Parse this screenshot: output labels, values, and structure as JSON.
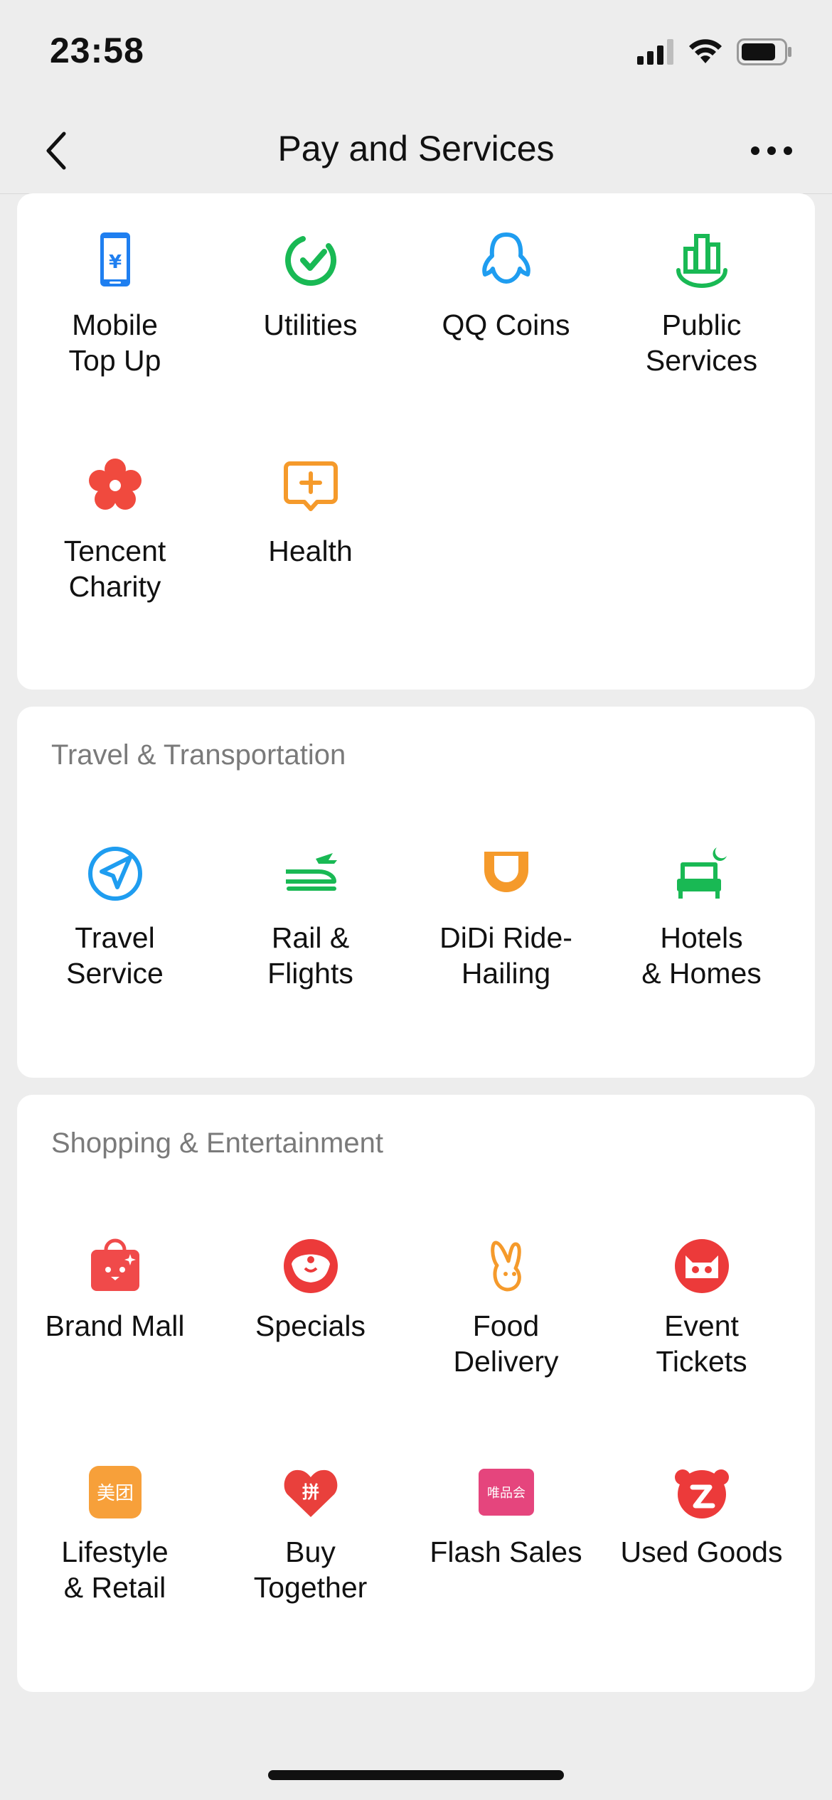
{
  "status": {
    "time": "23:58"
  },
  "nav": {
    "title": "Pay and Services"
  },
  "sections": [
    {
      "title": "",
      "items": [
        {
          "label": "Mobile\nTop Up",
          "icon": "mobile-top-up-icon",
          "color": "#1f7ff0"
        },
        {
          "label": "Utilities",
          "icon": "utilities-icon",
          "color": "#19b954"
        },
        {
          "label": "QQ Coins",
          "icon": "qq-coins-icon",
          "color": "#1f9df0"
        },
        {
          "label": "Public\nServices",
          "icon": "public-services-icon",
          "color": "#19b954"
        },
        {
          "label": "Tencent\nCharity",
          "icon": "tencent-charity-icon",
          "color": "#f04a3e"
        },
        {
          "label": "Health",
          "icon": "health-icon",
          "color": "#f59a2b"
        }
      ]
    },
    {
      "title": "Travel & Transportation",
      "items": [
        {
          "label": "Travel\nService",
          "icon": "travel-service-icon",
          "color": "#1f9df0"
        },
        {
          "label": "Rail &\nFlights",
          "icon": "rail-flights-icon",
          "color": "#19b954"
        },
        {
          "label": "DiDi Ride-\nHailing",
          "icon": "didi-ride-hailing-icon",
          "color": "#f59a2b"
        },
        {
          "label": "Hotels\n& Homes",
          "icon": "hotels-homes-icon",
          "color": "#19b954"
        }
      ]
    },
    {
      "title": "Shopping & Entertainment",
      "items": [
        {
          "label": "Brand Mall",
          "icon": "brand-mall-icon",
          "color": "#f04a4a"
        },
        {
          "label": "Specials",
          "icon": "specials-icon",
          "color": "#ec3a3a"
        },
        {
          "label": "Food\nDelivery",
          "icon": "food-delivery-icon",
          "color": "#f59a2b"
        },
        {
          "label": "Event\nTickets",
          "icon": "event-tickets-icon",
          "color": "#ec3a3a"
        },
        {
          "label": "Lifestyle\n& Retail",
          "icon": "lifestyle-retail-icon",
          "color": "#f7a03a",
          "badge": "美团"
        },
        {
          "label": "Buy\nTogether",
          "icon": "buy-together-icon",
          "color": "#e9403c",
          "badge": "拼"
        },
        {
          "label": "Flash Sales",
          "icon": "flash-sales-icon",
          "color": "#e5457d",
          "badge": "唯品会"
        },
        {
          "label": "Used Goods",
          "icon": "used-goods-icon",
          "color": "#ec3a3a"
        }
      ]
    }
  ]
}
